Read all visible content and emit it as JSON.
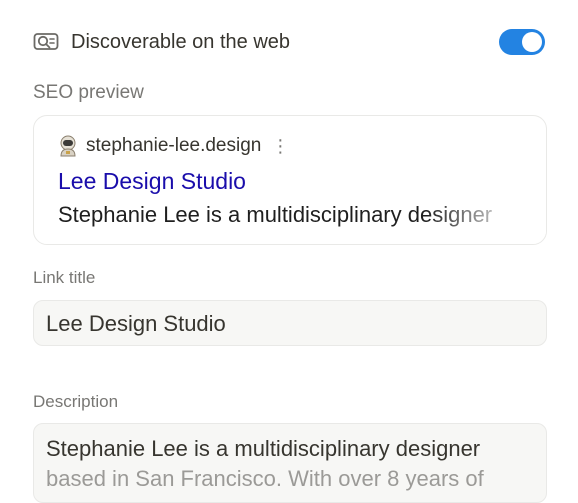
{
  "discover": {
    "label": "Discoverable on the web",
    "enabled": true,
    "accent": "#2383e2"
  },
  "seo": {
    "section_label": "SEO preview",
    "site": "stephanie-lee.design",
    "menu_glyph": "⋮",
    "title": "Lee Design Studio",
    "description": "Stephanie Lee is a multidisciplinary designer",
    "title_color": "#1a0dab"
  },
  "link_title": {
    "label": "Link title",
    "value": "Lee Design Studio"
  },
  "description": {
    "label": "Description",
    "line1": "Stephanie Lee is a multidisciplinary designer",
    "line2": "based in San Francisco. With over 8 years of"
  }
}
